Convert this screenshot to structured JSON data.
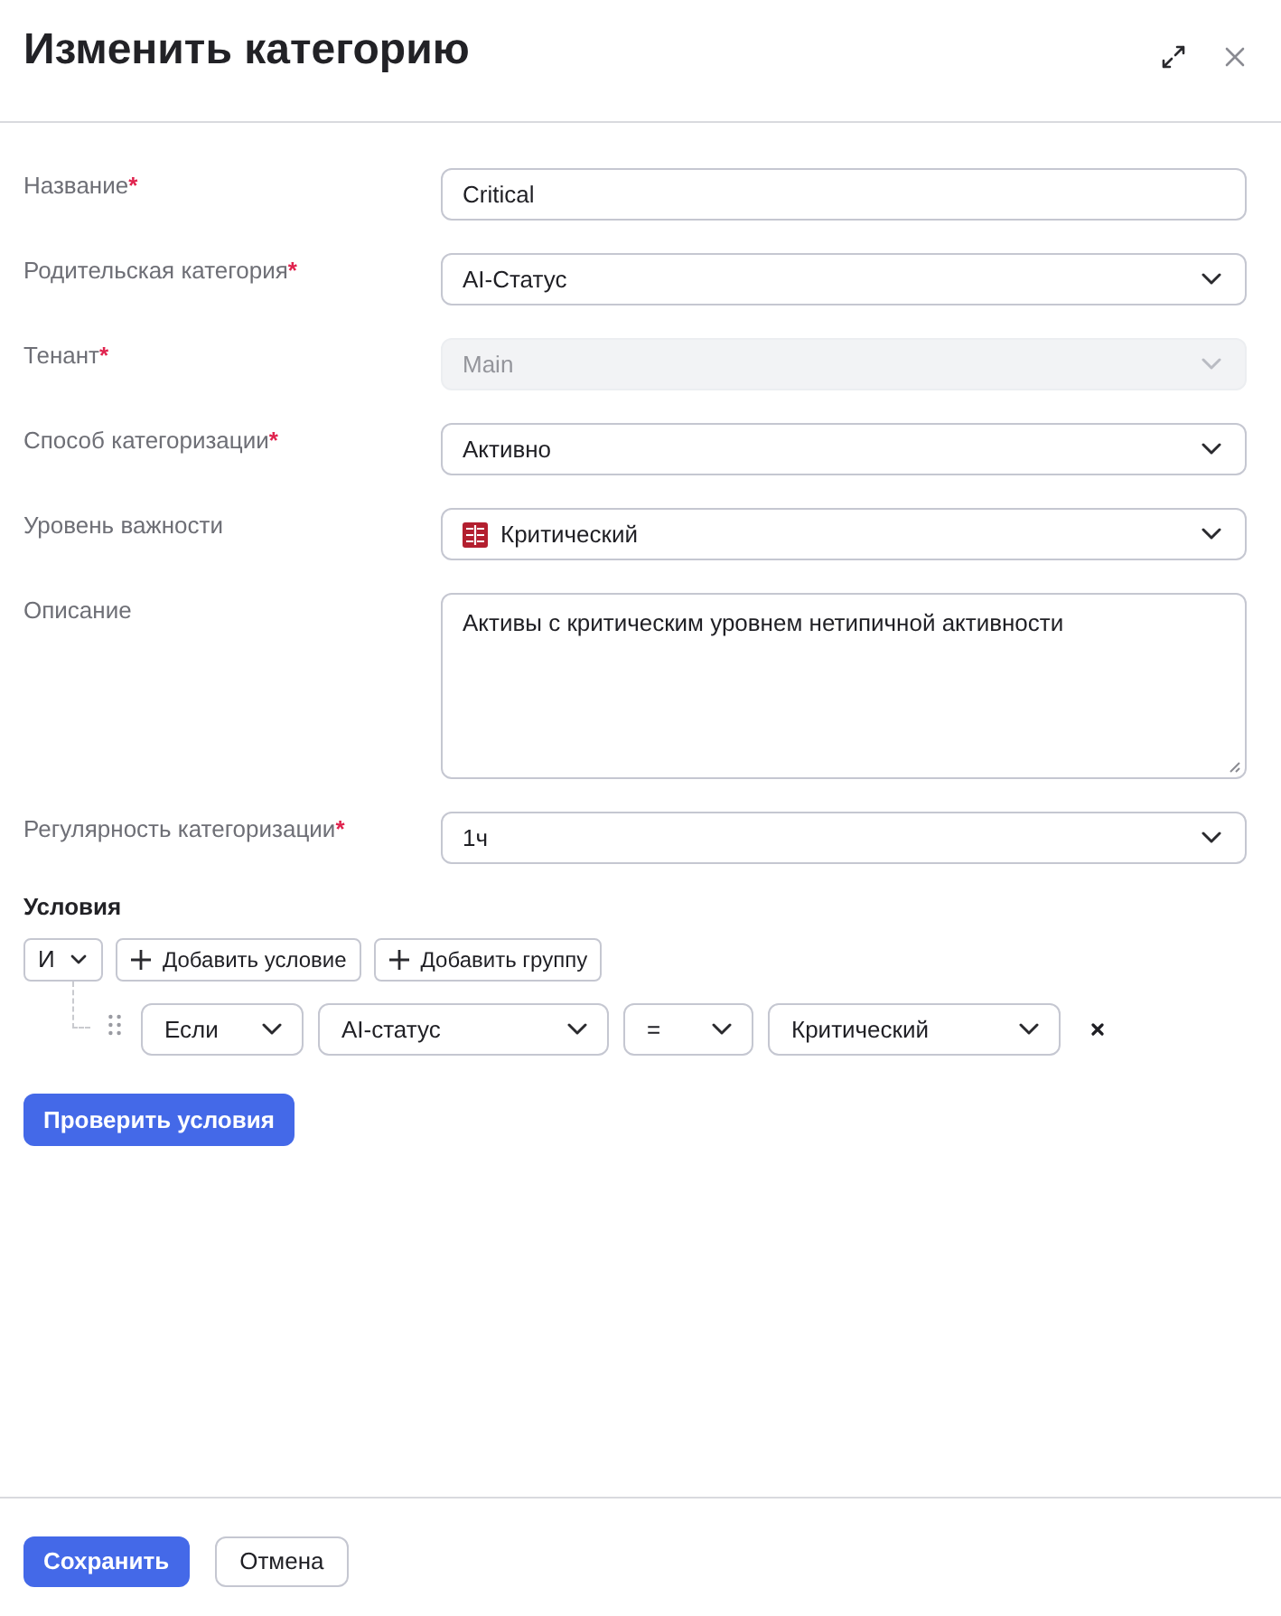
{
  "header": {
    "title": "Изменить категорию"
  },
  "fields": [
    {
      "label": "Название",
      "required_mark": "*",
      "kind": "text",
      "value": "Critical",
      "disabled": false
    },
    {
      "label": "Родительская категория",
      "required_mark": "*",
      "kind": "select",
      "value": "AI-Статус",
      "disabled": false
    },
    {
      "label": "Тенант",
      "required_mark": "*",
      "kind": "select",
      "value": "Main",
      "disabled": true
    },
    {
      "label": "Способ категоризации",
      "required_mark": "*",
      "kind": "select",
      "value": "Активно",
      "disabled": false
    },
    {
      "label": "Уровень важности",
      "kind": "icon-select",
      "value": "Критический",
      "disabled": false
    },
    {
      "label": "Описание",
      "kind": "textarea",
      "value": "Активы с критическим уровнем нетипичной активности",
      "disabled": false
    },
    {
      "label": "Регулярность категоризации",
      "required_mark": "*",
      "kind": "select",
      "value": "1ч",
      "disabled": false
    }
  ],
  "conditions": {
    "title": "Условия",
    "operator": "И",
    "actions": [
      "Добавить условие",
      "Добавить группу"
    ],
    "rules": [
      {
        "selects": [
          "Если",
          "AI-статус",
          "=",
          "Критический"
        ]
      }
    ],
    "check_button": "Проверить условия"
  },
  "footer": {
    "buttons": [
      {
        "label": "Сохранить",
        "kind": "primary"
      },
      {
        "label": "Отмена",
        "kind": "secondary"
      }
    ]
  }
}
